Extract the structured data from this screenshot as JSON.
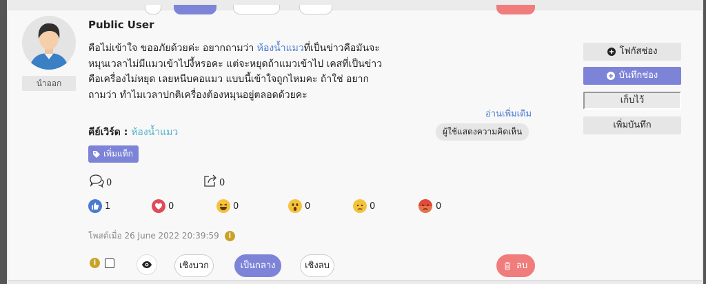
{
  "user": {
    "name": "Public User",
    "logout_label": "นำออก"
  },
  "post": {
    "lines": [
      {
        "before": "คือไม่เข้าใจ ขออภัยด้วยค่ะ อยากถามว่า ",
        "keyword": "ห้องน้ำแมว",
        "after": "ที่เป็นข่าวคือมันจะ"
      },
      {
        "before": "หมุนเวลาไม่มีแมวเข้าไปงี้หรอคะ แต่จะหยุดถ้าแมวเข้าไป เคสที่เป็นข่าว",
        "keyword": "",
        "after": ""
      },
      {
        "before": "คือเครื่องไม่หยุด เลยหนีบคอแมว แบบนี้เข้าใจถูกไหมคะ ถ้าใช่ อยาก",
        "keyword": "",
        "after": ""
      },
      {
        "before": "ถามว่า ทำไมเวลาปกติเครื่องต้องหมุนอยู่ตลอดด้วยคะ",
        "keyword": "",
        "after": ""
      }
    ],
    "read_more": "อ่านเพิ่มเติม",
    "show_comments": "ผู้ใช้แสดงความคิดเห็น",
    "keyword_label": "คีย์เวิร์ด :",
    "keyword_value": "ห้องน้ำแมว",
    "add_tag": "เพิ่มแท็ก",
    "comment_count": "0",
    "share_count": "0",
    "posted_at": "โพสต์เมื่อ 26 June 2022 20:39:59"
  },
  "reactions": [
    {
      "name": "like",
      "count": "1",
      "color": "#4a7bd0"
    },
    {
      "name": "love",
      "count": "0",
      "color": "#e04a5a"
    },
    {
      "name": "haha",
      "count": "0",
      "color": "#f5c33b"
    },
    {
      "name": "wow",
      "count": "0",
      "color": "#f5c33b"
    },
    {
      "name": "sad",
      "count": "0",
      "color": "#f5c33b"
    },
    {
      "name": "angry",
      "count": "0",
      "color": "#e8734a"
    }
  ],
  "actions": {
    "positive": "เชิงบวก",
    "neutral": "เป็นกลาง",
    "negative": "เชิงลบ",
    "delete": "ลบ"
  },
  "side": {
    "focus": "โฟกัสช่อง",
    "save": "บันทึกช่อง",
    "keep": "เก็บไว้",
    "add_note": "เพิ่มบันทึก"
  },
  "colors": {
    "accent": "#7d84d8",
    "danger": "#f07c7c",
    "link": "#4a7bd0",
    "keyword": "#4bb3c4"
  }
}
